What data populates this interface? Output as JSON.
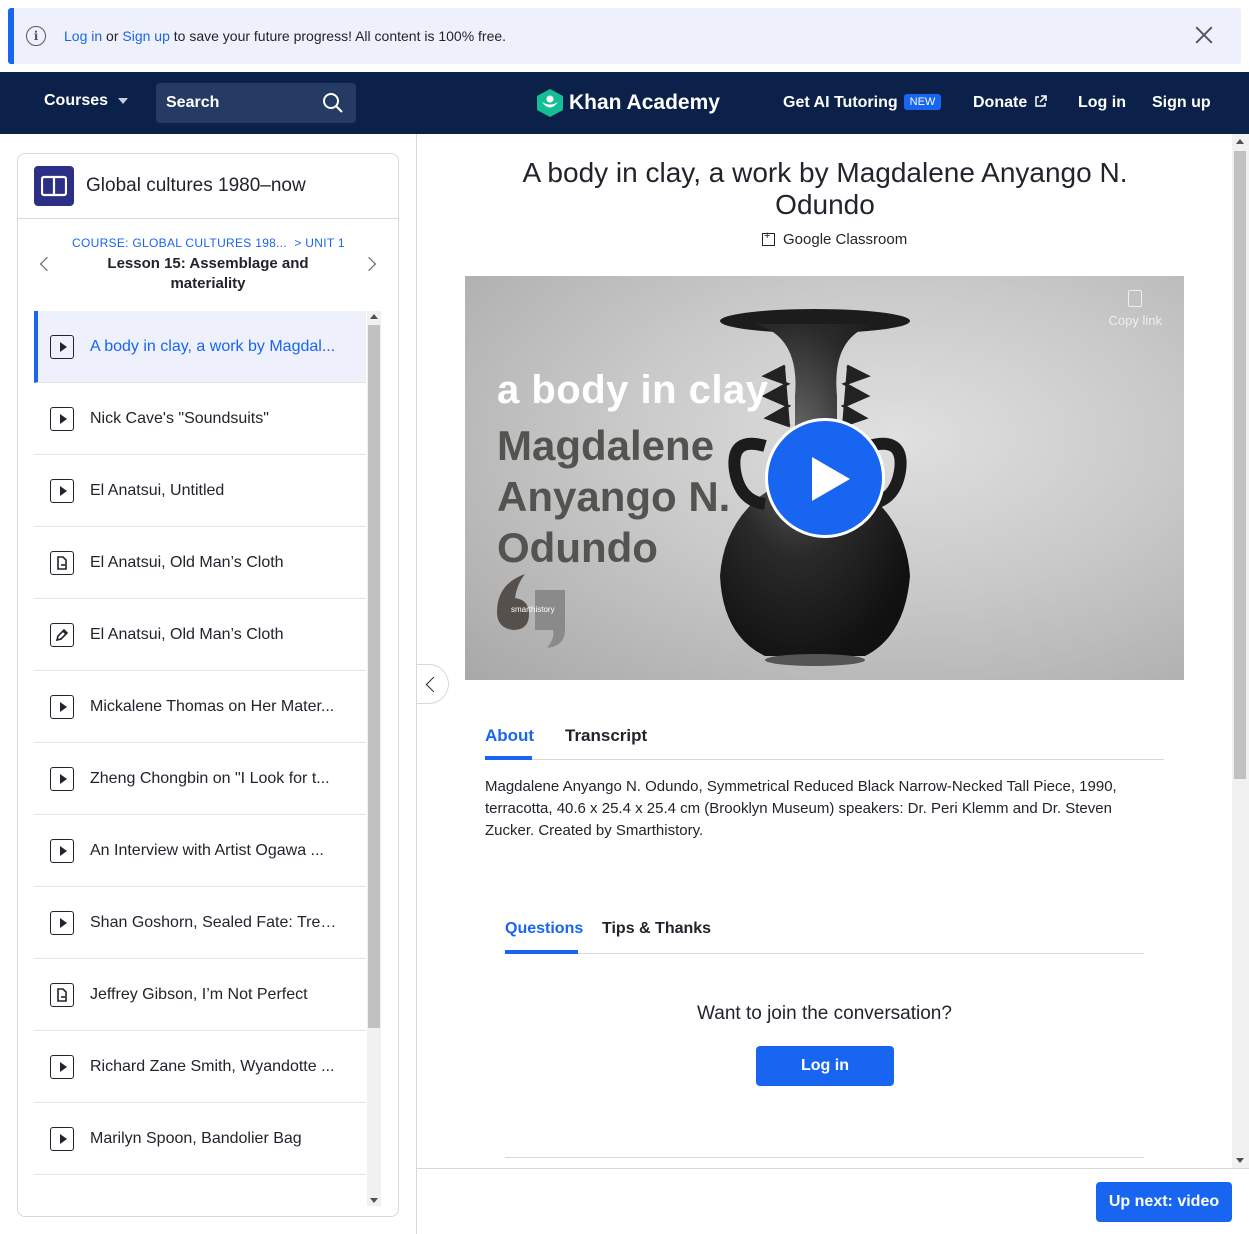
{
  "banner": {
    "login_link": "Log in",
    "or": "or",
    "signup_link": "Sign up",
    "message": "to save your future progress! All content is 100% free."
  },
  "nav": {
    "courses": "Courses",
    "search_placeholder": "Search",
    "logo": "Khan Academy",
    "ai_tutoring": "Get AI Tutoring",
    "new_badge": "NEW",
    "donate": "Donate",
    "login": "Log in",
    "signup": "Sign up"
  },
  "sidebar": {
    "course_title": "Global cultures 1980–now",
    "breadcrumb_course": "COURSE: GLOBAL CULTURES 198...",
    "breadcrumb_unit": "> UNIT 1",
    "lesson": "Lesson 15: Assemblage and materiality",
    "items": [
      {
        "label": "A body in clay, a work by Magdal...",
        "icon": "play-icon",
        "active": true
      },
      {
        "label": "Nick Cave's \"Soundsuits\"",
        "icon": "play-icon"
      },
      {
        "label": "El Anatsui, Untitled",
        "icon": "play-icon"
      },
      {
        "label": "El Anatsui, Old Man’s Cloth",
        "icon": "article-icon"
      },
      {
        "label": "El Anatsui, Old Man’s Cloth",
        "icon": "pencil-icon"
      },
      {
        "label": "Mickalene Thomas on Her Mater...",
        "icon": "play-icon"
      },
      {
        "label": "Zheng Chongbin on \"I Look for t...",
        "icon": "play-icon"
      },
      {
        "label": "An Interview with Artist Ogawa ...",
        "icon": "play-icon"
      },
      {
        "label": "Shan Goshorn, Sealed Fate: Treat...",
        "icon": "play-icon"
      },
      {
        "label": "Jeffrey Gibson, I’m Not Perfect",
        "icon": "article-icon"
      },
      {
        "label": "Richard Zane Smith, Wyandotte ...",
        "icon": "play-icon"
      },
      {
        "label": "Marilyn Spoon, Bandolier Bag",
        "icon": "play-icon"
      }
    ]
  },
  "main": {
    "title": "A body in clay, a work by Magdalene Anyango N. Odundo",
    "google_classroom": "Google Classroom",
    "video": {
      "overlay_line1": "a body in clay",
      "overlay_line2": "Magdalene",
      "overlay_line3": "Anyango N.",
      "overlay_line4": "Odundo",
      "copy_link": "Copy link",
      "brand": "smarthistory"
    },
    "tabs": [
      "About",
      "Transcript"
    ],
    "description": "Magdalene Anyango N. Odundo, Symmetrical Reduced Black Narrow-Necked Tall Piece, 1990, terracotta, 40.6 x 25.4 x 25.4 cm (Brooklyn Museum) speakers: Dr. Peri Klemm and Dr. Steven Zucker. Created by Smarthistory.",
    "discussion_tabs": [
      "Questions",
      "Tips & Thanks"
    ],
    "join_prompt": "Want to join the conversation?",
    "login_button": "Log in",
    "up_next": "Up next: video"
  },
  "colors": {
    "accent": "#1865f2",
    "nav_bg": "#0b2149"
  }
}
